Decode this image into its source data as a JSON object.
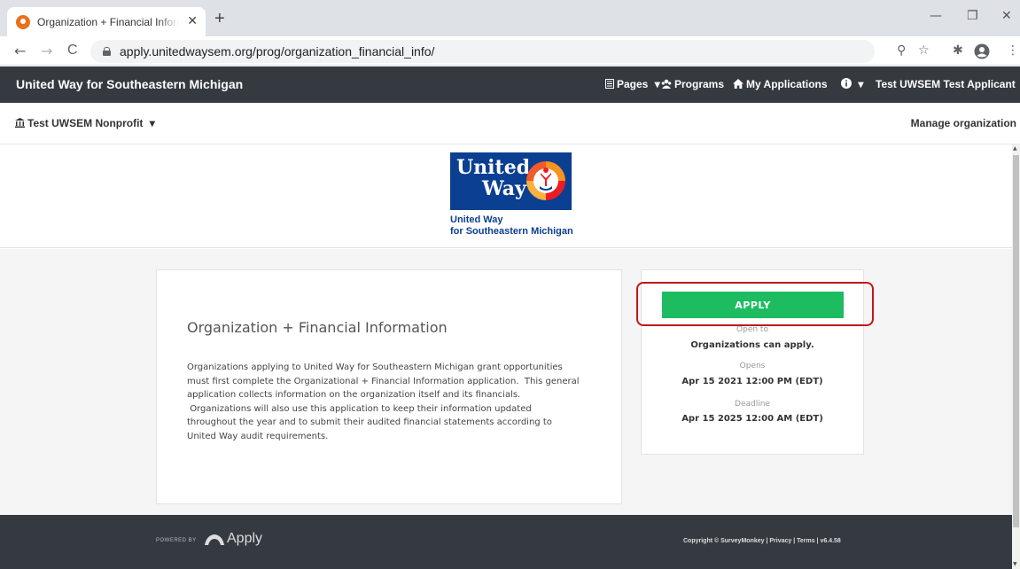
{
  "browser": {
    "tab_title": "Organization + Financial Informa",
    "tab_close": "✕",
    "new_tab": "+",
    "url": "apply.unitedwaysem.org/prog/organization_financial_info/",
    "back": "←",
    "forward": "→",
    "reload": "C",
    "window_minimize": "—",
    "window_restore": "❐",
    "window_close": "✕",
    "zoom_icon": "⚲",
    "star_icon": "☆",
    "extensions_icon": "✱",
    "menu_icon": "⋮"
  },
  "nav": {
    "brand": "United Way for Southeastern Michigan",
    "pages": "Pages",
    "programs": "Programs",
    "my_applications": "My Applications",
    "user": "Test UWSEM Test Applicant",
    "caret": "▾"
  },
  "org_bar": {
    "org_name": "Test UWSEM Nonprofit",
    "manage": "Manage organization"
  },
  "logo": {
    "word1": "United",
    "word2": "Way",
    "sub1": "United Way",
    "sub2": "for Southeastern Michigan"
  },
  "program": {
    "title": "Organization + Financial Information",
    "description": "Organizations applying to United Way for Southeastern Michigan grant opportunities\nmust first complete the Organizational + Financial Information application.  This general\napplication collects information on the organization itself and its financials.\n Organizations will also use this application to keep their information updated\nthroughout the year and to submit their audited financial statements according to\nUnited Way audit requirements."
  },
  "sidebar": {
    "apply_label": "APPLY",
    "open_to_label": "Open to",
    "open_to_value": "Organizations can apply.",
    "opens_label": "Opens",
    "opens_value": "Apr 15 2021 12:00 PM (EDT)",
    "deadline_label": "Deadline",
    "deadline_value": "Apr 15 2025 12:00 AM (EDT)"
  },
  "footer": {
    "powered_by": "POWERED BY",
    "apply_logo": "Apply",
    "copyright": "Copyright © SurveyMonkey | Privacy | Terms | v6.4.58"
  },
  "colors": {
    "navbar": "#343a40",
    "apply_button": "#1ebc61",
    "highlight": "#c0171d",
    "logo_blue": "#0a3f91"
  }
}
